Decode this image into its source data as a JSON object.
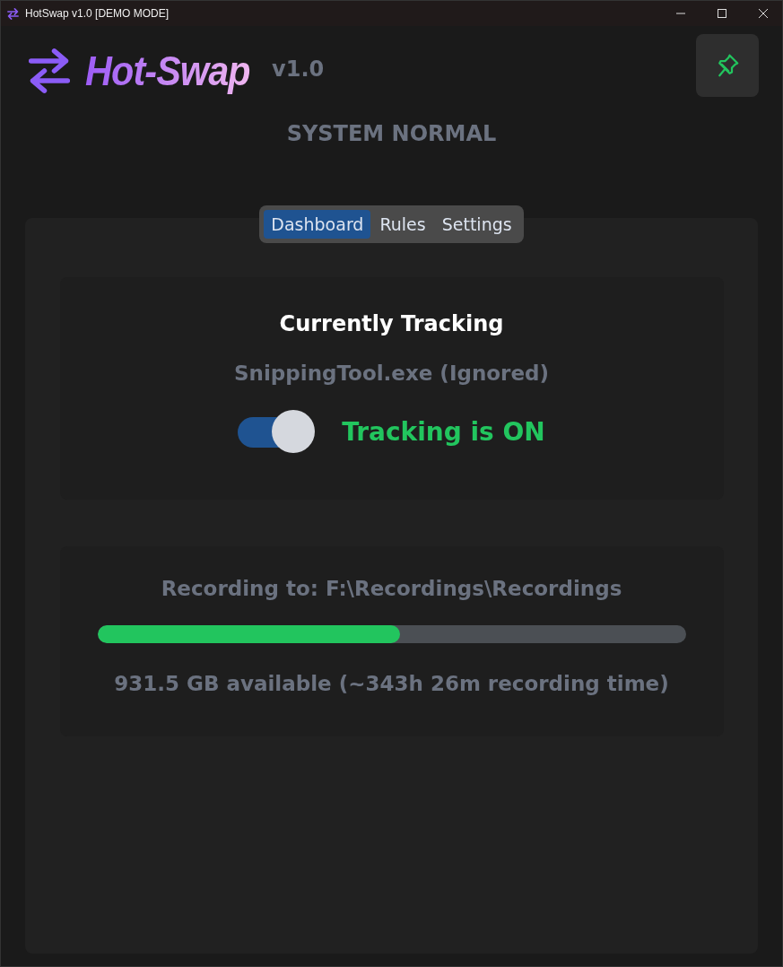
{
  "window": {
    "title": "HotSwap v1.0 [DEMO MODE]"
  },
  "header": {
    "logo_text": "Hot-Swap",
    "version": "v1.0",
    "pinned": true
  },
  "status": "SYSTEM NORMAL",
  "tabs": [
    {
      "label": "Dashboard",
      "selected": true
    },
    {
      "label": "Rules",
      "selected": false
    },
    {
      "label": "Settings",
      "selected": false
    }
  ],
  "tracking": {
    "title": "Currently Tracking",
    "process": "SnippingTool.exe (Ignored)",
    "on": true,
    "label": "Tracking is ON"
  },
  "storage": {
    "path": "Recording to: F:\\Recordings\\Recordings",
    "level": 0.515,
    "summary": "931.5 GB available (~343h 26m recording time)"
  }
}
